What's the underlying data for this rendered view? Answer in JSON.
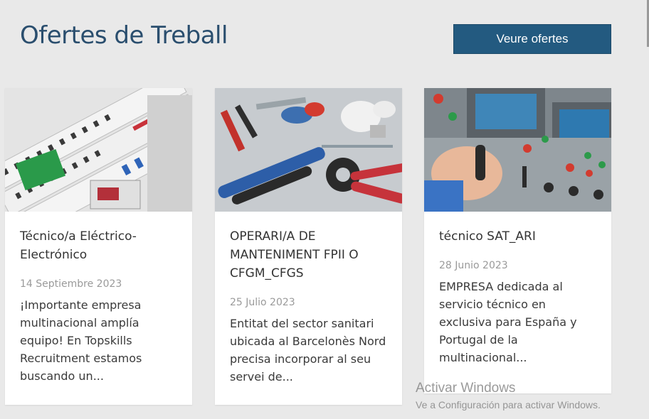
{
  "header": {
    "title": "Ofertes de Treball",
    "cta_label": "Veure ofertes"
  },
  "cards": [
    {
      "title": "Técnico/a Eléctrico-Electrónico",
      "date": "14 Septiembre 2023",
      "excerpt": "¡Importante empresa multinacional amplía equipo! En Topskills Recruitment estamos buscando un...",
      "image": "electrical-panel-image"
    },
    {
      "title": "OPERARI/A DE MANTENIMENT FPII O CFGM_CFGS",
      "date": "25 Julio 2023",
      "excerpt": "Entitat del sector sanitari ubicada al Barcelonès Nord precisa incorporar al seu servei de...",
      "image": "tools-image"
    },
    {
      "title": "técnico SAT_ARI",
      "date": "28 Junio 2023",
      "excerpt": "EMPRESA dedicada al servicio técnico en exclusiva para España y Portugal de la multinacional...",
      "image": "control-console-image"
    }
  ],
  "watermark": {
    "title": "Activar Windows",
    "subtitle": "Ve a Configuración para activar Windows."
  },
  "colors": {
    "background": "#e9e9e9",
    "title": "#2a4e6e",
    "button": "#235a80"
  }
}
